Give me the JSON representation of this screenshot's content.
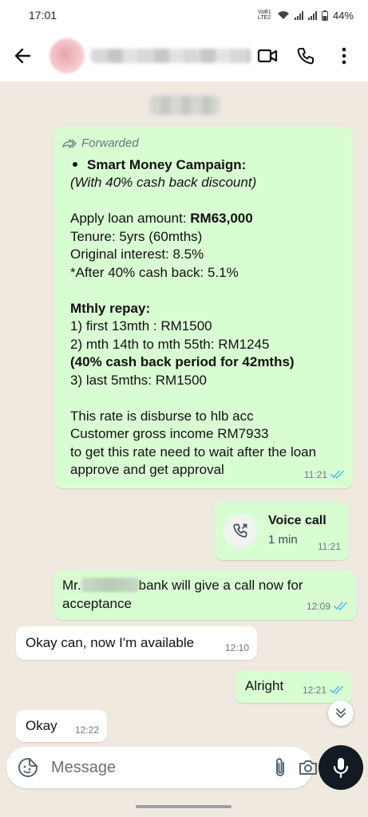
{
  "status_bar": {
    "time": "17:01",
    "volte": "VoB1 LTE2",
    "battery": "44%"
  },
  "header": {
    "back_icon": "arrow-left-icon",
    "video_icon": "videocam-icon",
    "call_icon": "phone-icon",
    "menu_icon": "more-vert-icon"
  },
  "messages": {
    "forwarded": {
      "forwarded_label": "Forwarded",
      "line1": "Smart Money Campaign:",
      "line2": "(With  40% cash back discount)",
      "line3_prefix": "Apply loan amount: ",
      "line3_amount": "RM63,000",
      "line4": "Tenure: 5yrs (60mths)",
      "line5": "Original interest: 8.5%",
      "line6": "*After 40% cash back: 5.1%",
      "line7": "Mthly repay:",
      "line8": "1) first 13mth : RM1500",
      "line9": "2) mth 14th to mth 55th: RM1245",
      "line10": "(40% cash back period for 42mths)",
      "line11": "3) last 5mths: RM1500",
      "line12": "This rate is disburse to hlb acc",
      "line13": "Customer gross income RM7933",
      "line14": "to get this rate need to wait after the loan",
      "line15": "approve and get approval",
      "time": "11:21"
    },
    "voice_call": {
      "title": "Voice call",
      "duration": "1 min",
      "time": "11:21"
    },
    "mr_message": {
      "prefix": "Mr.",
      "text": "bank will give a call now for",
      "text2": "acceptance",
      "time": "12:09"
    },
    "incoming1": {
      "text": "Okay can, now I'm available",
      "time": "12:10"
    },
    "outgoing_alright": {
      "text": "Alright",
      "time": "12:21"
    },
    "incoming2": {
      "text": "Okay",
      "time": "12:22"
    }
  },
  "input": {
    "placeholder": "Message"
  },
  "colors": {
    "outgoing_bubble": "#d9fdd3",
    "incoming_bubble": "#ffffff",
    "read_ticks": "#53bdeb",
    "mic_button": "#111b21",
    "chat_background": "#efe9e0"
  }
}
